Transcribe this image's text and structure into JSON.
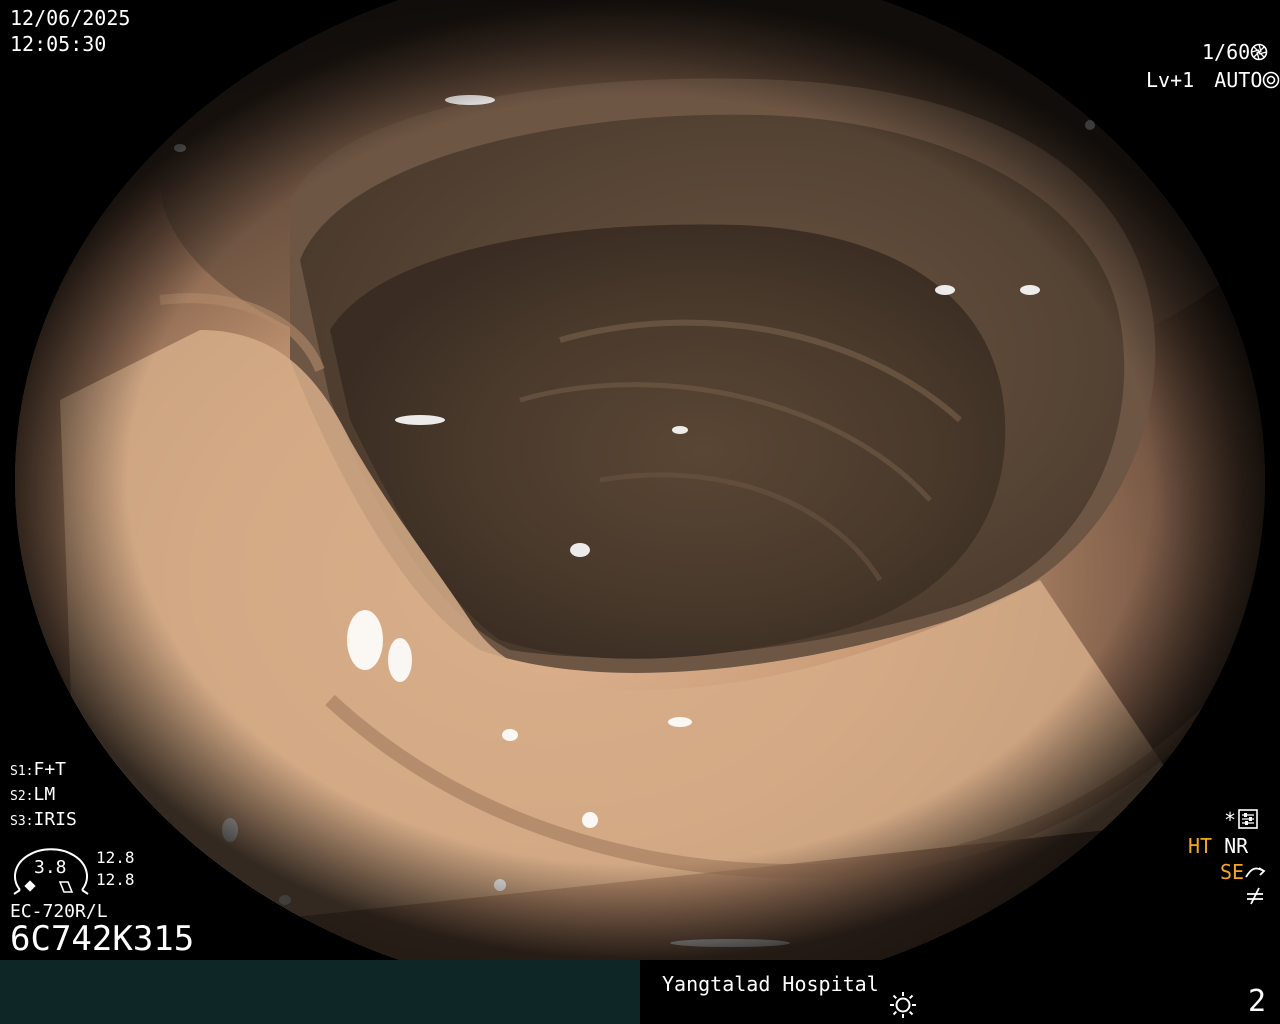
{
  "overlay": {
    "date": "12/06/2025",
    "time": "12:05:30",
    "shutter": "1/60",
    "level": "Lv+1",
    "exposure_mode": "AUTO",
    "s1": {
      "prefix": "S1:",
      "value": "F+T"
    },
    "s2": {
      "prefix": "S2:",
      "value": "LM"
    },
    "s3": {
      "prefix": "S3:",
      "value": "IRIS"
    },
    "gauge_value": "3.8",
    "gauge_right_top": "12.8",
    "gauge_right_bottom": "12.8",
    "scope_model": "EC-720R/L",
    "serial": "6C742K315",
    "asterisk": "*",
    "ht_label": "HT",
    "nr_label": "NR",
    "se_label": "SE"
  },
  "status_bar": {
    "hospital": "Yangtalad Hospital",
    "page_number": "2"
  },
  "icons": {
    "shutter_icon": "aperture-icon",
    "auto_icon": "camera-icon",
    "settings_icon": "sliders-icon",
    "brightness_icon": "sun-icon",
    "se_icon": "curve-arrow-icon",
    "not_equal_icon": "not-equal-icon"
  },
  "colors": {
    "accent_orange": "#f5a623",
    "status_left_bg": "#0e2626"
  }
}
